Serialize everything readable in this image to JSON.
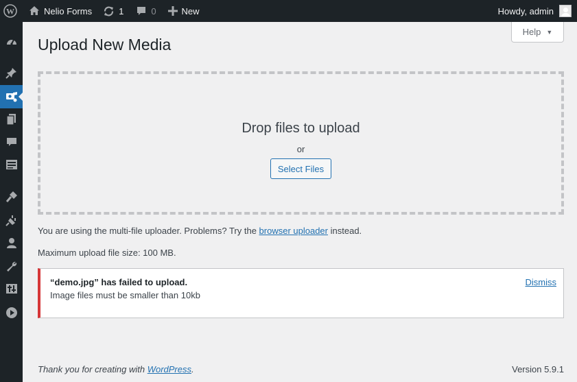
{
  "adminbar": {
    "site_name": "Nelio Forms",
    "updates_count": "1",
    "comments_count": "0",
    "new_label": "New",
    "greeting": "Howdy, admin"
  },
  "sidebar": {
    "items": [
      {
        "icon": "dashboard-icon"
      },
      {
        "icon": "pin-icon"
      },
      {
        "icon": "media-icon",
        "active": true
      },
      {
        "icon": "pages-icon"
      },
      {
        "icon": "comments-icon"
      },
      {
        "icon": "forms-icon"
      },
      {
        "icon": "appearance-icon"
      },
      {
        "icon": "plugins-icon"
      },
      {
        "icon": "users-icon"
      },
      {
        "icon": "tools-icon"
      },
      {
        "icon": "settings-icon"
      },
      {
        "icon": "play-icon"
      }
    ]
  },
  "help": {
    "label": "Help"
  },
  "page": {
    "title": "Upload New Media"
  },
  "uploader": {
    "drop_text": "Drop files to upload",
    "or_text": "or",
    "select_files_label": "Select Files",
    "multi_text_before": "You are using the multi-file uploader. Problems? Try the",
    "browser_uploader_link": "browser uploader",
    "multi_text_after": "instead.",
    "max_size_text": "Maximum upload file size: 100 MB."
  },
  "error": {
    "title": "“demo.jpg” has failed to upload.",
    "message": "Image files must be smaller than 10kb",
    "dismiss_label": "Dismiss"
  },
  "footer": {
    "thanks_text": "Thank you for creating with",
    "wordpress_link": "WordPress",
    "period": ".",
    "version": "Version 5.9.1"
  },
  "colors": {
    "accent": "#2271b1",
    "adminbar_bg": "#1d2327",
    "error": "#d63638",
    "background": "#f0f0f1"
  }
}
